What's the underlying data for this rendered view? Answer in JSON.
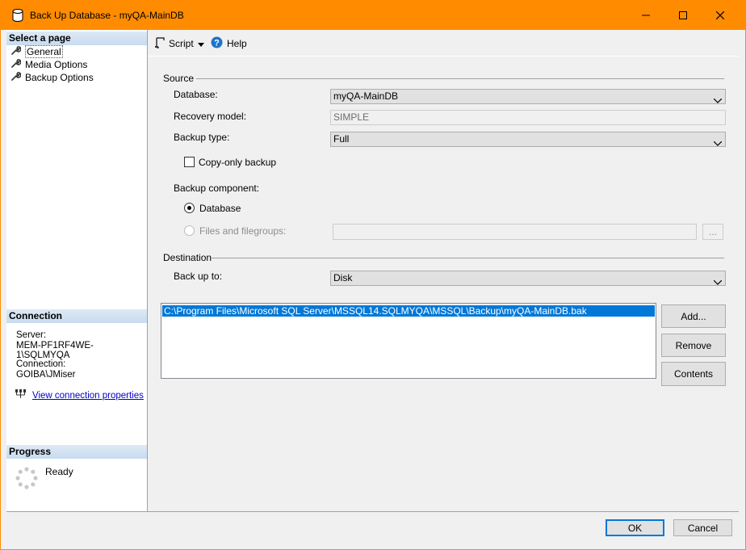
{
  "window": {
    "title": "Back Up Database - myQA-MainDB",
    "controls": {
      "minimize": "—",
      "maximize": "☐",
      "close": "✕"
    }
  },
  "left": {
    "select_page_header": "Select a page",
    "pages": [
      {
        "label": "General",
        "icon": "wrench-icon",
        "selected": true
      },
      {
        "label": "Media Options",
        "icon": "wrench-icon",
        "selected": false
      },
      {
        "label": "Backup Options",
        "icon": "wrench-icon",
        "selected": false
      }
    ],
    "connection_header": "Connection",
    "server_label": "Server:",
    "server_value": "MEM-PF1RF4WE-1\\SQLMYQA",
    "connection_label": "Connection:",
    "connection_value": "GOIBA\\JMiser",
    "view_connection_link": "View connection properties",
    "progress_header": "Progress",
    "progress_status": "Ready"
  },
  "toolbar": {
    "script_label": "Script",
    "help_label": "Help"
  },
  "source": {
    "group_label": "Source",
    "database_label": "Database:",
    "database_value": "myQA-MainDB",
    "recovery_label": "Recovery model:",
    "recovery_value": "SIMPLE",
    "backup_type_label": "Backup type:",
    "backup_type_value": "Full",
    "copy_only_label": "Copy-only backup",
    "copy_only_checked": false,
    "component_label": "Backup component:",
    "component_database_label": "Database",
    "component_files_label": "Files and filegroups:",
    "browse_label": "..."
  },
  "destination": {
    "group_label": "Destination",
    "backup_to_label": "Back up to:",
    "backup_to_value": "Disk",
    "paths": [
      "C:\\Program Files\\Microsoft SQL Server\\MSSQL14.SQLMYQA\\MSSQL\\Backup\\myQA-MainDB.bak"
    ],
    "add_label": "Add...",
    "remove_label": "Remove",
    "contents_label": "Contents"
  },
  "footer": {
    "ok_label": "OK",
    "cancel_label": "Cancel"
  },
  "colors": {
    "titlebar": "#ff8c00",
    "selection": "#0078d7",
    "link": "#0000cc"
  }
}
